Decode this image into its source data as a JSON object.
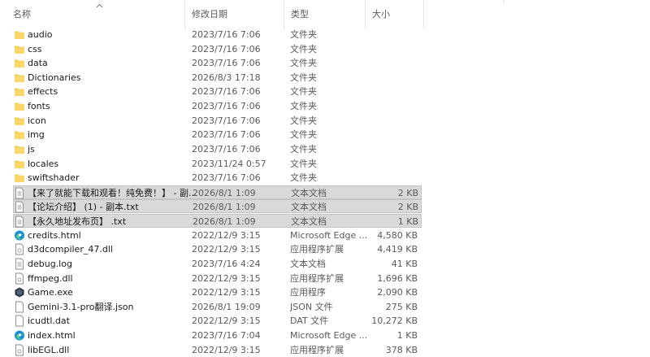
{
  "columns": {
    "name": "名称",
    "date": "修改日期",
    "type": "类型",
    "size": "大小"
  },
  "files": [
    {
      "name": "audio",
      "date": "2023/7/16 7:06",
      "type": "文件夹",
      "size": "",
      "icon": "folder-icon",
      "selected": false
    },
    {
      "name": "css",
      "date": "2023/7/16 7:06",
      "type": "文件夹",
      "size": "",
      "icon": "folder-icon",
      "selected": false
    },
    {
      "name": "data",
      "date": "2023/7/16 7:06",
      "type": "文件夹",
      "size": "",
      "icon": "folder-icon",
      "selected": false
    },
    {
      "name": "Dictionaries",
      "date": "2026/8/3 17:18",
      "type": "文件夹",
      "size": "",
      "icon": "folder-icon",
      "selected": false
    },
    {
      "name": "effects",
      "date": "2023/7/16 7:06",
      "type": "文件夹",
      "size": "",
      "icon": "folder-icon",
      "selected": false
    },
    {
      "name": "fonts",
      "date": "2023/7/16 7:06",
      "type": "文件夹",
      "size": "",
      "icon": "folder-icon",
      "selected": false
    },
    {
      "name": "icon",
      "date": "2023/7/16 7:06",
      "type": "文件夹",
      "size": "",
      "icon": "folder-icon",
      "selected": false
    },
    {
      "name": "img",
      "date": "2023/7/16 7:06",
      "type": "文件夹",
      "size": "",
      "icon": "folder-icon",
      "selected": false
    },
    {
      "name": "js",
      "date": "2023/7/16 7:06",
      "type": "文件夹",
      "size": "",
      "icon": "folder-icon",
      "selected": false
    },
    {
      "name": "locales",
      "date": "2023/11/24 0:57",
      "type": "文件夹",
      "size": "",
      "icon": "folder-icon",
      "selected": false
    },
    {
      "name": "swiftshader",
      "date": "2023/7/16 7:06",
      "type": "文件夹",
      "size": "",
      "icon": "folder-icon",
      "selected": false
    },
    {
      "name": "【来了就能下载和观看！纯免费！】 - 副...",
      "date": "2026/8/1 1:09",
      "type": "文本文档",
      "size": "2 KB",
      "icon": "text-file-icon",
      "selected": true
    },
    {
      "name": "【论坛介绍】 (1) - 副本.txt",
      "date": "2026/8/1 1:09",
      "type": "文本文档",
      "size": "2 KB",
      "icon": "text-file-icon",
      "selected": true
    },
    {
      "name": "【永久地址发布页】 .txt",
      "date": "2026/8/1 1:09",
      "type": "文本文档",
      "size": "1 KB",
      "icon": "text-file-icon",
      "selected": true
    },
    {
      "name": "credits.html",
      "date": "2022/12/9 3:15",
      "type": "Microsoft Edge ...",
      "size": "4,580 KB",
      "icon": "edge-icon",
      "selected": false
    },
    {
      "name": "d3dcompiler_47.dll",
      "date": "2022/12/9 3:15",
      "type": "应用程序扩展",
      "size": "4,419 KB",
      "icon": "dll-file-icon",
      "selected": false
    },
    {
      "name": "debug.log",
      "date": "2023/7/16 4:24",
      "type": "文本文档",
      "size": "41 KB",
      "icon": "text-file-icon",
      "selected": false
    },
    {
      "name": "ffmpeg.dll",
      "date": "2022/12/9 3:15",
      "type": "应用程序扩展",
      "size": "1,696 KB",
      "icon": "dll-file-icon",
      "selected": false
    },
    {
      "name": "Game.exe",
      "date": "2022/12/9 3:15",
      "type": "应用程序",
      "size": "2,090 KB",
      "icon": "game-exe-icon",
      "selected": false
    },
    {
      "name": "Gemini-3.1-pro翻译.json",
      "date": "2026/8/1 19:09",
      "type": "JSON 文件",
      "size": "275 KB",
      "icon": "file-icon",
      "selected": false
    },
    {
      "name": "icudtl.dat",
      "date": "2022/12/9 3:15",
      "type": "DAT 文件",
      "size": "10,272 KB",
      "icon": "file-icon",
      "selected": false
    },
    {
      "name": "index.html",
      "date": "2023/7/16 7:04",
      "type": "Microsoft Edge ...",
      "size": "1 KB",
      "icon": "edge-icon",
      "selected": false
    },
    {
      "name": "libEGL.dll",
      "date": "2022/12/9 3:15",
      "type": "应用程序扩展",
      "size": "378 KB",
      "icon": "dll-file-icon",
      "selected": false
    }
  ]
}
